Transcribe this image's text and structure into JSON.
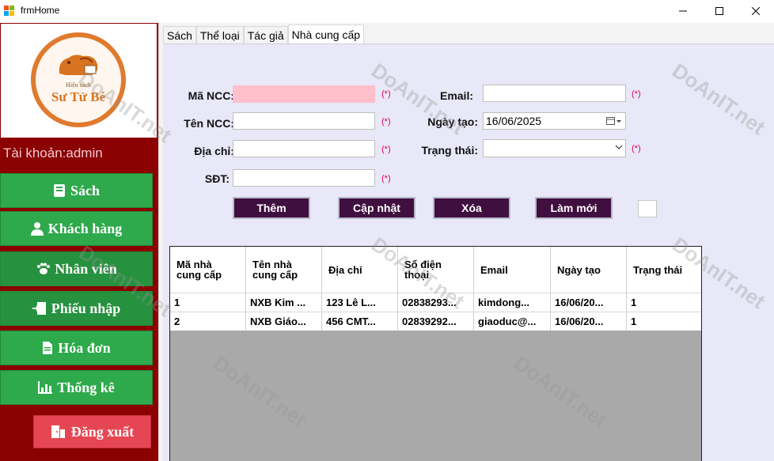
{
  "window": {
    "title": "frmHome",
    "min_label": "—",
    "max_label": "☐",
    "close_label": "✕"
  },
  "logo": {
    "top_text": "Hiệu sách",
    "main_text": "Sư Tử Bé"
  },
  "sidebar": {
    "account": "Tài khoản:admin",
    "items": [
      {
        "label": "Sách",
        "icon": "book-icon"
      },
      {
        "label": "Khách hàng",
        "icon": "user-icon"
      },
      {
        "label": "Nhân viên",
        "icon": "paw-icon"
      },
      {
        "label": "Phiếu nhập",
        "icon": "import-icon"
      },
      {
        "label": "Hóa đơn",
        "icon": "receipt-icon"
      },
      {
        "label": "Thống kê",
        "icon": "chart-icon"
      }
    ],
    "logout": "Đăng xuất"
  },
  "tabs": [
    "Sách",
    "Thể loại",
    "Tác giả",
    "Nhà cung cấp"
  ],
  "active_tab": "Nhà cung cấp",
  "form": {
    "ma_ncc_label": "Mã NCC:",
    "ma_ncc_value": "",
    "ten_ncc_label": "Tên NCC:",
    "ten_ncc_value": "",
    "dia_chi_label": "Địa chỉ:",
    "dia_chi_value": "",
    "sdt_label": "SĐT:",
    "sdt_value": "",
    "email_label": "Email:",
    "email_value": "",
    "ngay_tao_label": "Ngày tạo:",
    "ngay_tao_value": "16/06/2025",
    "trang_thai_label": "Trạng thái:",
    "trang_thai_value": "",
    "required_mark": "(*)"
  },
  "buttons": {
    "add": "Thêm",
    "update": "Cập nhật",
    "delete": "Xóa",
    "refresh": "Làm mới"
  },
  "grid": {
    "columns": [
      "Mã nhà cung cấp",
      "Tên nhà cung cấp",
      "Địa chỉ",
      "Số điện thoại",
      "Email",
      "Ngày tạo",
      "Trạng thái"
    ],
    "rows": [
      [
        "1",
        "NXB Kim ...",
        "123 Lê L...",
        "02838293...",
        "kimdong...",
        "16/06/20...",
        "1"
      ],
      [
        "2",
        "NXB Giáo...",
        "456 CMT...",
        "02839292...",
        "giaoduc@...",
        "16/06/20...",
        "1"
      ]
    ]
  },
  "watermark": "DoAnIT.net",
  "colors": {
    "sidebar_bg": "#8b0000",
    "nav_green": "#2ea94b",
    "logout_red": "#e64654",
    "action_btn": "#3f0f3f",
    "tab_page_bg": "#e8e8f8",
    "required": "#e0004d",
    "pink_field": "#ffc0cb"
  }
}
